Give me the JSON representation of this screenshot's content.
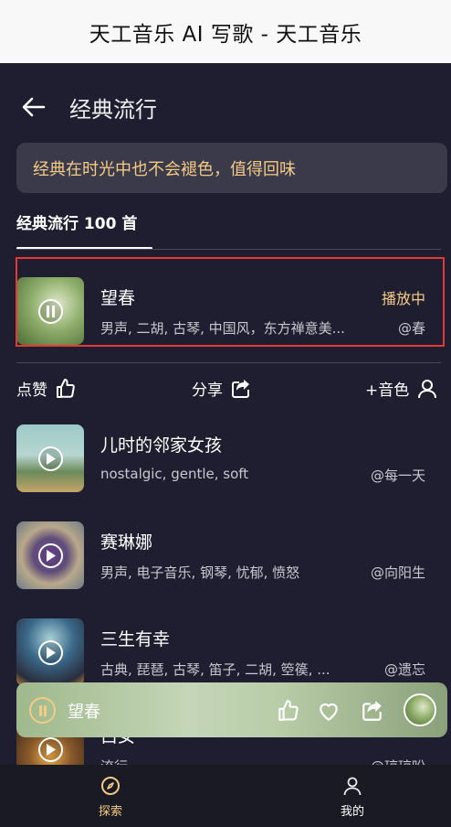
{
  "app": {
    "title": "天工音乐 AI 写歌 - 天工音乐"
  },
  "header": {
    "title": "经典流行"
  },
  "banner": {
    "text": "经典在时光中也不会褪色，值得回味"
  },
  "tabs": {
    "active": "经典流行 100 首"
  },
  "current_song": {
    "name": "望春",
    "tags": "男声, 二胡, 古琴, 中国风，东方禅意美...",
    "author": "@春",
    "status": "播放中"
  },
  "actions": {
    "like": "点赞",
    "share": "分享",
    "voice": "+音色"
  },
  "songs": [
    {
      "name": "儿时的邻家女孩",
      "tags": "nostalgic, gentle, soft",
      "author": "@每一天"
    },
    {
      "name": "赛琳娜",
      "tags": "男声, 电子音乐, 钢琴, 忧郁, 愤怒",
      "author": "@向阳生"
    },
    {
      "name": "三生有幸",
      "tags": "古典, 琵琶, 古琴, 笛子, 二胡, 箜篌, ...",
      "author": "@遗忘"
    },
    {
      "name": "白女",
      "tags": "流行",
      "author": "@琼琼昖"
    }
  ],
  "player": {
    "name": "望春"
  },
  "nav": {
    "explore": "探索",
    "mine": "我的"
  },
  "colors": {
    "accent": "#f4cb85",
    "background": "#1f1e30",
    "highlight": "#e53935"
  }
}
